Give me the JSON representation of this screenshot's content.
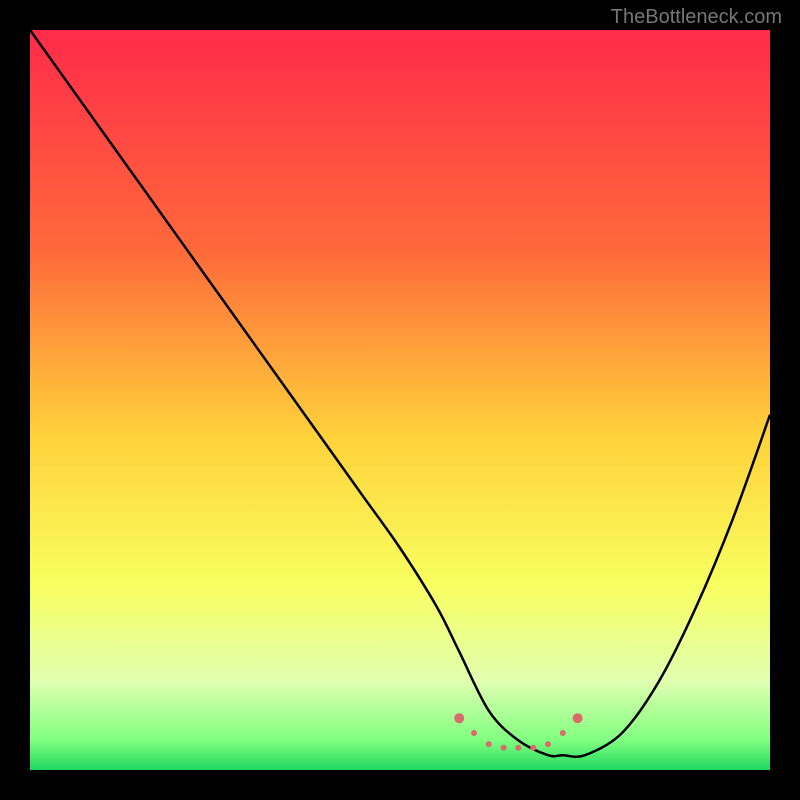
{
  "watermark": "TheBottleneck.com",
  "chart_data": {
    "type": "line",
    "title": "",
    "xlabel": "",
    "ylabel": "",
    "xlim": [
      0,
      100
    ],
    "ylim": [
      0,
      100
    ],
    "grid": false,
    "background_gradient": {
      "stops": [
        {
          "offset": 0,
          "color": "#ff2a4a"
        },
        {
          "offset": 30,
          "color": "#ff6a3a"
        },
        {
          "offset": 55,
          "color": "#ffd23a"
        },
        {
          "offset": 75,
          "color": "#f8ff60"
        },
        {
          "offset": 88,
          "color": "#e0ffb0"
        },
        {
          "offset": 96,
          "color": "#80ff80"
        },
        {
          "offset": 100,
          "color": "#20d860"
        }
      ]
    },
    "series": [
      {
        "name": "bottleneck-curve",
        "color": "#000000",
        "x": [
          0,
          5,
          10,
          15,
          20,
          25,
          30,
          35,
          40,
          45,
          50,
          55,
          58,
          62,
          66,
          70,
          72,
          75,
          80,
          85,
          90,
          95,
          100
        ],
        "values": [
          100,
          93,
          86,
          79,
          72,
          65,
          58,
          51,
          44,
          37,
          30,
          22,
          16,
          8,
          4,
          2,
          2,
          2,
          5,
          12,
          22,
          34,
          48
        ]
      }
    ],
    "markers": {
      "name": "highlight-band",
      "color": "#d96b6b",
      "x": [
        58,
        60,
        62,
        64,
        66,
        68,
        70,
        72,
        74
      ],
      "values": [
        7,
        5,
        3.5,
        3,
        3,
        3,
        3.5,
        5,
        7
      ],
      "radius_end": 5,
      "radius_mid": 3
    }
  }
}
